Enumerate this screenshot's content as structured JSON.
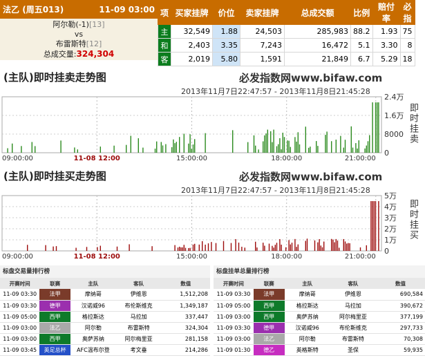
{
  "match": {
    "league": "法乙",
    "weekday": "(周五013)",
    "datetime": "11-09 03:00",
    "home": "阿尔勒(-1)",
    "home_rank": "[13]",
    "vs": "vs",
    "away": "布雷斯特",
    "away_rank": "[12]",
    "total_label": "总成交量:",
    "total_value": "324,304"
  },
  "odds_table": {
    "headers": [
      "项",
      "买家挂牌",
      "价位",
      "卖家挂牌",
      "总成交额",
      "比例",
      "赔付率",
      "必指"
    ],
    "rows": [
      [
        "主",
        "32,549",
        "1.88",
        "24,503",
        "285,983",
        "88.2",
        "1.93",
        "75"
      ],
      [
        "和",
        "2,403",
        "3.35",
        "7,243",
        "16,472",
        "5.1",
        "3.30",
        "8"
      ],
      [
        "客",
        "2,019",
        "5.80",
        "1,591",
        "21,849",
        "6.7",
        "5.29",
        "18"
      ]
    ]
  },
  "chart_sell": {
    "title": "(主队)即时挂卖走势图",
    "brand": "必发指数网www.bifaw.com",
    "range": "2013年11月7日22:47:57 - 2013年11月8日21:45:28",
    "ylabel": "即时挂卖",
    "color": "#2b8a1e",
    "ticks": [
      "2.4万",
      "1.6万",
      "8000",
      "0"
    ],
    "x_labels": [
      "09:00:00",
      "11-08 12:00",
      "15:00:00",
      "18:00:00",
      "21:00:00"
    ]
  },
  "chart_buy": {
    "title": "(主队)即时挂买走势图",
    "brand": "必发指数网www.bifaw.com",
    "range": "2013年11月7日22:47:57 - 2013年11月8日21:45:28",
    "ylabel": "即时挂买",
    "color": "#9c0a0a",
    "ticks": [
      "5万",
      "4万",
      "3万",
      "2万",
      "1万",
      "0"
    ],
    "x_labels": [
      "09:00:00",
      "11-08 12:00",
      "15:00:00",
      "18:00:00",
      "21:00:00"
    ]
  },
  "volume_rank": {
    "title": "标盘交易量排行榜",
    "headers": [
      "开赛时间",
      "联赛",
      "主队",
      "客队",
      "数值"
    ],
    "rows": [
      {
        "time": "11-09 03:30",
        "league": "法甲",
        "lcolor": "#7a3b2a",
        "home": "摩纳哥",
        "away": "伊维恩",
        "value": "1,512,208"
      },
      {
        "time": "11-09 03:30",
        "league": "德甲",
        "lcolor": "#9b2fae",
        "home": "汉诺威96",
        "away": "布伦斯维克",
        "value": "1,349,187"
      },
      {
        "time": "11-09 05:00",
        "league": "西甲",
        "lcolor": "#0e7a2a",
        "home": "格拉斯达",
        "away": "马拉加",
        "value": "337,447"
      },
      {
        "time": "11-09 03:00",
        "league": "法乙",
        "lcolor": "#a9a9a9",
        "home": "阿尔勒",
        "away": "布雷斯特",
        "value": "324,304"
      },
      {
        "time": "11-09 03:00",
        "league": "西甲",
        "lcolor": "#0e7a2a",
        "home": "奥萨苏纳",
        "away": "阿尔梅里亚",
        "value": "281,158"
      },
      {
        "time": "11-09 03:45",
        "league": "英足总杯",
        "lcolor": "#2450c8",
        "home": "AFC温布尔登",
        "away": "考文垂",
        "value": "214,286"
      }
    ]
  },
  "pending_rank": {
    "title": "标盘挂单总量排行榜",
    "headers": [
      "开赛时间",
      "联赛",
      "主队",
      "客队",
      "数值"
    ],
    "rows": [
      {
        "time": "11-09 03:30",
        "league": "法甲",
        "lcolor": "#7a3b2a",
        "home": "摩纳哥",
        "away": "伊维恩",
        "value": "690,584"
      },
      {
        "time": "11-09 05:00",
        "league": "西甲",
        "lcolor": "#0e7a2a",
        "home": "格拉斯达",
        "away": "马拉加",
        "value": "390,672"
      },
      {
        "time": "11-09 03:00",
        "league": "西甲",
        "lcolor": "#0e7a2a",
        "home": "奥萨苏纳",
        "away": "阿尔梅里亚",
        "value": "377,199"
      },
      {
        "time": "11-09 03:30",
        "league": "德甲",
        "lcolor": "#9b2fae",
        "home": "汉诺威96",
        "away": "布伦斯维克",
        "value": "297,733"
      },
      {
        "time": "11-09 03:00",
        "league": "法乙",
        "lcolor": "#a9a9a9",
        "home": "阿尔勒",
        "away": "布雷斯特",
        "value": "70,308"
      },
      {
        "time": "11-09 01:30",
        "league": "德乙",
        "lcolor": "#c62dc0",
        "home": "英格斯特",
        "away": "圣保",
        "value": "59,935"
      }
    ]
  }
}
